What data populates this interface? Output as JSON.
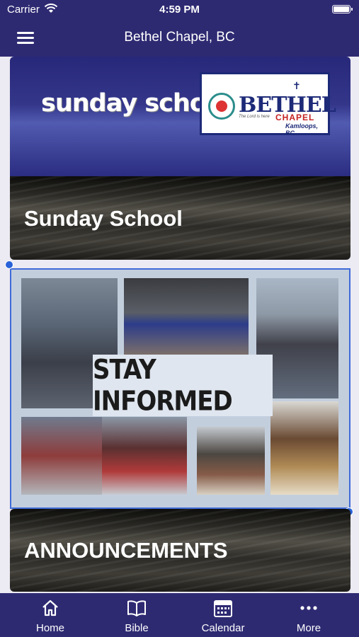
{
  "status_bar": {
    "carrier": "Carrier",
    "time": "4:59 PM"
  },
  "nav": {
    "title": "Bethel Chapel, BC",
    "menu_icon": "hamburger-menu-icon"
  },
  "cards": [
    {
      "banner_text": "sunday school",
      "logo": {
        "name": "BETHEL",
        "subname": "CHAPEL",
        "tagline": "The Lord is here",
        "location": "Kamloops, BC"
      },
      "title": "Sunday School"
    },
    {
      "banner_text": "STAY INFORMED",
      "title": "ANNOUNCEMENTS"
    }
  ],
  "tabs": [
    {
      "label": "Home",
      "icon": "home-icon"
    },
    {
      "label": "Bible",
      "icon": "book-icon"
    },
    {
      "label": "Calendar",
      "icon": "calendar-icon"
    },
    {
      "label": "More",
      "icon": "more-dots-icon"
    }
  ],
  "colors": {
    "brand": "#2e2a72",
    "accent": "#2a63d8",
    "background": "#eceaf2"
  }
}
